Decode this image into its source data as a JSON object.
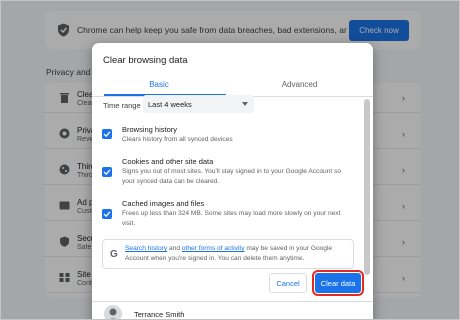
{
  "safety": {
    "text": "Chrome can help keep you safe from data breaches, bad extensions, and more",
    "button": "Check now"
  },
  "section_title": "Privacy and security",
  "rows": [
    {
      "title": "Clear browsing data",
      "desc": "Clear history, cookies, cache, and more",
      "icon": "trash-icon"
    },
    {
      "title": "Privacy guide",
      "desc": "Review key privacy and security controls",
      "icon": "privacy-icon"
    },
    {
      "title": "Third-party cookies",
      "desc": "Third-party cookies are blocked in Incognito mode",
      "icon": "cookie-icon"
    },
    {
      "title": "Ad privacy",
      "desc": "Customize the info used by sites to show you ads",
      "icon": "ad-icon"
    },
    {
      "title": "Security",
      "desc": "Safe Browsing (protection from dangerous sites)",
      "icon": "security-icon"
    },
    {
      "title": "Site settings",
      "desc": "Controls what information sites can use and show",
      "icon": "site-settings-icon"
    }
  ],
  "dialog": {
    "title": "Clear browsing data",
    "tabs": {
      "basic": "Basic",
      "advanced": "Advanced"
    },
    "time_range_label": "Time range",
    "time_range_value": "Last 4 weeks",
    "options": [
      {
        "title": "Browsing history",
        "desc": "Clears history from all synced devices",
        "checked": true
      },
      {
        "title": "Cookies and other site data",
        "desc": "Signs you out of most sites. You'll stay signed in to your Google Account so your synced data can be cleared.",
        "checked": true
      },
      {
        "title": "Cached images and files",
        "desc": "Frees up less than 324 MB. Some sites may load more slowly on your next visit.",
        "checked": true
      }
    ],
    "info": {
      "link1": "Search history",
      "mid": " and ",
      "link2": "other forms of activity",
      "rest": " may be saved in your Google Account when you're signed in. You can delete them anytime."
    },
    "cancel_label": "Cancel",
    "clear_label": "Clear data",
    "account_name": "Terrance Smith"
  }
}
